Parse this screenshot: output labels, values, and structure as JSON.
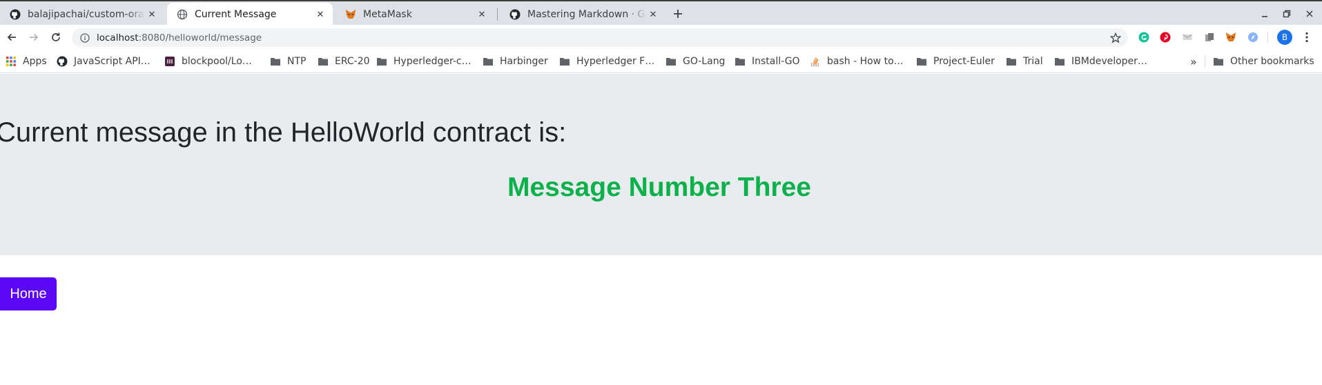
{
  "browser": {
    "tabs": [
      {
        "title": "balajipachai/custom-orac",
        "favicon": "github-icon",
        "active": false
      },
      {
        "title": "Current Message",
        "favicon": "globe-icon",
        "active": true
      },
      {
        "title": "MetaMask",
        "favicon": "metamask-fox-icon",
        "active": false
      },
      {
        "title": "Mastering Markdown · Git",
        "favicon": "github-icon",
        "active": false
      }
    ],
    "address_bar": {
      "host": "localhost",
      "path": ":8080/helloworld/message"
    },
    "bookmarks": [
      {
        "label": "Apps",
        "icon": "apps-grid-icon"
      },
      {
        "label": "JavaScript API…",
        "icon": "github-icon"
      },
      {
        "label": "blockpool/Lo…",
        "icon": "site-favicon-icon"
      },
      {
        "label": "NTP",
        "icon": "folder-icon"
      },
      {
        "label": "ERC-20",
        "icon": "folder-icon"
      },
      {
        "label": "Hyperledger-c…",
        "icon": "folder-icon"
      },
      {
        "label": "Harbinger",
        "icon": "folder-icon"
      },
      {
        "label": "Hyperledger F…",
        "icon": "folder-icon"
      },
      {
        "label": "GO-Lang",
        "icon": "folder-icon"
      },
      {
        "label": "Install-GO",
        "icon": "folder-icon"
      },
      {
        "label": "bash - How to…",
        "icon": "stackoverflow-icon"
      },
      {
        "label": "Project-Euler",
        "icon": "folder-icon"
      },
      {
        "label": "Trial",
        "icon": "folder-icon"
      },
      {
        "label": "IBMdeveloper…",
        "icon": "folder-icon"
      }
    ],
    "bookmarks_overflow": "»",
    "other_bookmarks": "Other bookmarks",
    "profile_initial": "B"
  },
  "page": {
    "heading": "Current message in the HelloWorld contract is:",
    "message": "Message Number Three",
    "home_button": "Home"
  },
  "colors": {
    "message": "#0db14b",
    "home_button_bg": "#5b08f7",
    "jumbotron_bg": "#e9ecef"
  }
}
